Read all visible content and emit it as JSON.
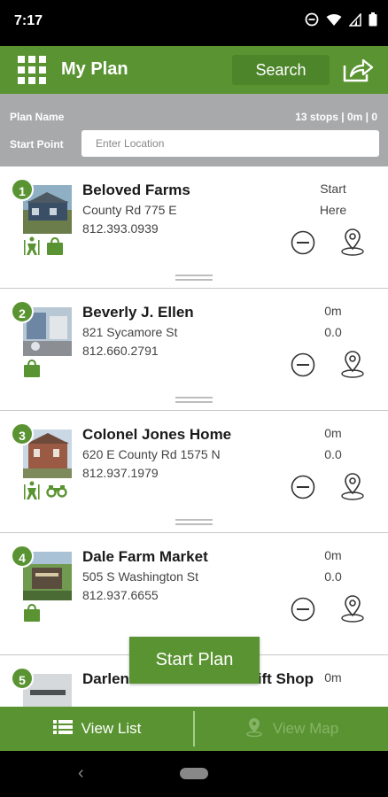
{
  "status_bar": {
    "time": "7:17"
  },
  "app_bar": {
    "title": "My Plan",
    "search_label": "Search"
  },
  "plan_info": {
    "plan_name_label": "Plan Name",
    "start_point_label": "Start Point",
    "stats": "13 stops | 0m | 0",
    "location_placeholder": "Enter Location"
  },
  "stops": [
    {
      "number": "1",
      "name": "Beloved Farms",
      "address": "County Rd 775 E",
      "phone": "812.393.0939",
      "meta1": "Start",
      "meta2": "Here",
      "tags": [
        "farm-worker-icon",
        "shopping-bag-icon"
      ]
    },
    {
      "number": "2",
      "name": "Beverly J. Ellen",
      "address": "821 Sycamore St",
      "phone": "812.660.2791",
      "meta1": "0m",
      "meta2": "0.0",
      "tags": [
        "shopping-bag-icon"
      ]
    },
    {
      "number": "3",
      "name": "Colonel Jones Home",
      "address": "620 E County Rd 1575 N",
      "phone": "812.937.1979",
      "meta1": "0m",
      "meta2": "0.0",
      "tags": [
        "farm-worker-icon",
        "binoculars-icon"
      ]
    },
    {
      "number": "4",
      "name": "Dale Farm Market",
      "address": "505 S Washington St",
      "phone": "812.937.6655",
      "meta1": "0m",
      "meta2": "0.0",
      "tags": [
        "shopping-bag-icon"
      ]
    },
    {
      "number": "5",
      "name": "Darlene's Flowers and Gift Shop",
      "address": "",
      "phone": "",
      "meta1": "0m",
      "meta2": "",
      "tags": []
    }
  ],
  "start_plan_label": "Start Plan",
  "bottom_bar": {
    "view_list_label": "View List",
    "view_map_label": "View Map"
  },
  "colors": {
    "accent": "#5a9432",
    "plan_bar": "#a7a9ab",
    "inactive_tab": "#86b467"
  }
}
